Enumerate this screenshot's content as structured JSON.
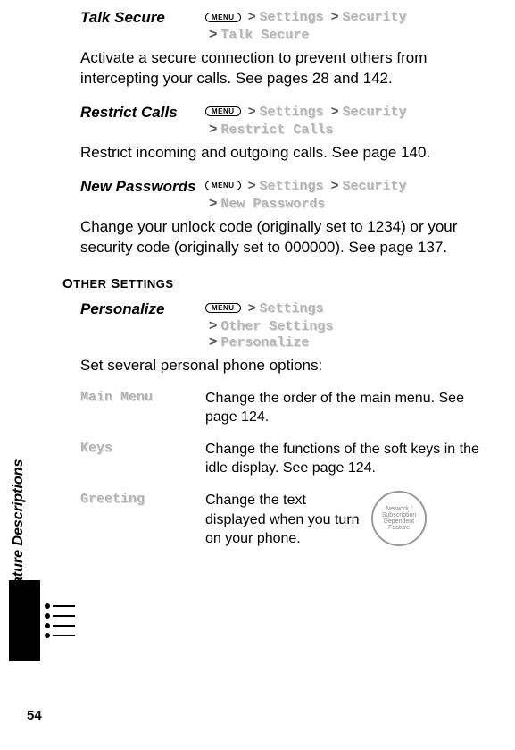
{
  "sidetab": "Menu Feature Descriptions",
  "page_number": "54",
  "menu_button": "MENU",
  "greater": ">",
  "path_tokens": {
    "settings": "Settings",
    "security": "Security",
    "other_settings": "Other Settings"
  },
  "features": [
    {
      "title": "Talk Secure",
      "leaf": "Talk Secure",
      "desc": "Activate a secure connection to prevent others from intercepting your calls. See pages 28 and 142."
    },
    {
      "title": "Restrict Calls",
      "leaf": "Restrict Calls",
      "desc": "Restrict incoming and outgoing calls. See page 140."
    },
    {
      "title": "New Passwords",
      "leaf": "New Passwords",
      "desc": "Change your unlock code (originally set to 1234) or your security code (originally set to 000000). See page 137."
    }
  ],
  "section_head": {
    "o": "O",
    "ther": "THER",
    "s": " S",
    "ettings": "ETTINGS"
  },
  "personalize": {
    "title": "Personalize",
    "leaf": "Personalize",
    "desc": "Set several personal phone options:"
  },
  "options": [
    {
      "label": "Main Menu",
      "desc": "Change the order of the main menu. See page 124."
    },
    {
      "label": "Keys",
      "desc": "Change the functions of the soft keys in the idle display. See page 124."
    },
    {
      "label": "Greeting",
      "desc": "Change the text displayed when you turn on your phone."
    }
  ],
  "badge_text": "Network / Subscription Dependent Feature"
}
